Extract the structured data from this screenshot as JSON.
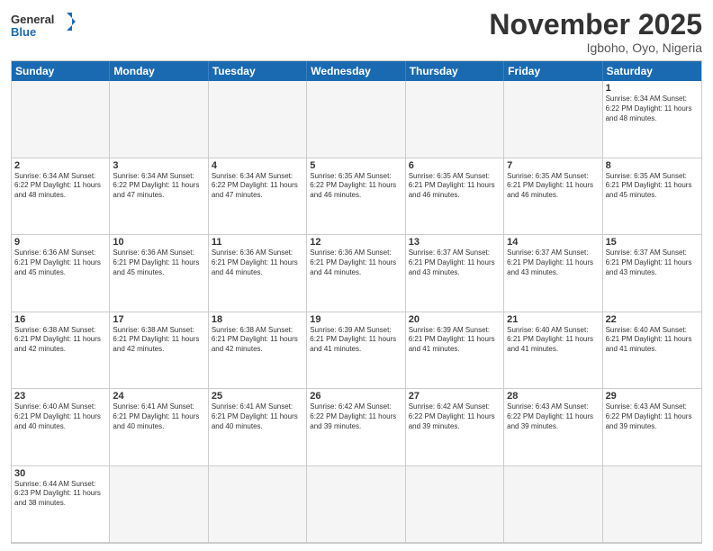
{
  "logo": {
    "general": "General",
    "blue": "Blue"
  },
  "header": {
    "month": "November 2025",
    "location": "Igboho, Oyo, Nigeria"
  },
  "days_of_week": [
    "Sunday",
    "Monday",
    "Tuesday",
    "Wednesday",
    "Thursday",
    "Friday",
    "Saturday"
  ],
  "weeks": [
    [
      {
        "day": "",
        "info": "",
        "empty": true
      },
      {
        "day": "",
        "info": "",
        "empty": true
      },
      {
        "day": "",
        "info": "",
        "empty": true
      },
      {
        "day": "",
        "info": "",
        "empty": true
      },
      {
        "day": "",
        "info": "",
        "empty": true
      },
      {
        "day": "",
        "info": "",
        "empty": true
      },
      {
        "day": "1",
        "info": "Sunrise: 6:34 AM\nSunset: 6:22 PM\nDaylight: 11 hours\nand 48 minutes."
      }
    ],
    [
      {
        "day": "2",
        "info": "Sunrise: 6:34 AM\nSunset: 6:22 PM\nDaylight: 11 hours\nand 48 minutes."
      },
      {
        "day": "3",
        "info": "Sunrise: 6:34 AM\nSunset: 6:22 PM\nDaylight: 11 hours\nand 47 minutes."
      },
      {
        "day": "4",
        "info": "Sunrise: 6:34 AM\nSunset: 6:22 PM\nDaylight: 11 hours\nand 47 minutes."
      },
      {
        "day": "5",
        "info": "Sunrise: 6:35 AM\nSunset: 6:22 PM\nDaylight: 11 hours\nand 46 minutes."
      },
      {
        "day": "6",
        "info": "Sunrise: 6:35 AM\nSunset: 6:21 PM\nDaylight: 11 hours\nand 46 minutes."
      },
      {
        "day": "7",
        "info": "Sunrise: 6:35 AM\nSunset: 6:21 PM\nDaylight: 11 hours\nand 46 minutes."
      },
      {
        "day": "8",
        "info": "Sunrise: 6:35 AM\nSunset: 6:21 PM\nDaylight: 11 hours\nand 45 minutes."
      }
    ],
    [
      {
        "day": "9",
        "info": "Sunrise: 6:36 AM\nSunset: 6:21 PM\nDaylight: 11 hours\nand 45 minutes."
      },
      {
        "day": "10",
        "info": "Sunrise: 6:36 AM\nSunset: 6:21 PM\nDaylight: 11 hours\nand 45 minutes."
      },
      {
        "day": "11",
        "info": "Sunrise: 6:36 AM\nSunset: 6:21 PM\nDaylight: 11 hours\nand 44 minutes."
      },
      {
        "day": "12",
        "info": "Sunrise: 6:36 AM\nSunset: 6:21 PM\nDaylight: 11 hours\nand 44 minutes."
      },
      {
        "day": "13",
        "info": "Sunrise: 6:37 AM\nSunset: 6:21 PM\nDaylight: 11 hours\nand 43 minutes."
      },
      {
        "day": "14",
        "info": "Sunrise: 6:37 AM\nSunset: 6:21 PM\nDaylight: 11 hours\nand 43 minutes."
      },
      {
        "day": "15",
        "info": "Sunrise: 6:37 AM\nSunset: 6:21 PM\nDaylight: 11 hours\nand 43 minutes."
      }
    ],
    [
      {
        "day": "16",
        "info": "Sunrise: 6:38 AM\nSunset: 6:21 PM\nDaylight: 11 hours\nand 42 minutes."
      },
      {
        "day": "17",
        "info": "Sunrise: 6:38 AM\nSunset: 6:21 PM\nDaylight: 11 hours\nand 42 minutes."
      },
      {
        "day": "18",
        "info": "Sunrise: 6:38 AM\nSunset: 6:21 PM\nDaylight: 11 hours\nand 42 minutes."
      },
      {
        "day": "19",
        "info": "Sunrise: 6:39 AM\nSunset: 6:21 PM\nDaylight: 11 hours\nand 41 minutes."
      },
      {
        "day": "20",
        "info": "Sunrise: 6:39 AM\nSunset: 6:21 PM\nDaylight: 11 hours\nand 41 minutes."
      },
      {
        "day": "21",
        "info": "Sunrise: 6:40 AM\nSunset: 6:21 PM\nDaylight: 11 hours\nand 41 minutes."
      },
      {
        "day": "22",
        "info": "Sunrise: 6:40 AM\nSunset: 6:21 PM\nDaylight: 11 hours\nand 41 minutes."
      }
    ],
    [
      {
        "day": "23",
        "info": "Sunrise: 6:40 AM\nSunset: 6:21 PM\nDaylight: 11 hours\nand 40 minutes."
      },
      {
        "day": "24",
        "info": "Sunrise: 6:41 AM\nSunset: 6:21 PM\nDaylight: 11 hours\nand 40 minutes."
      },
      {
        "day": "25",
        "info": "Sunrise: 6:41 AM\nSunset: 6:21 PM\nDaylight: 11 hours\nand 40 minutes."
      },
      {
        "day": "26",
        "info": "Sunrise: 6:42 AM\nSunset: 6:22 PM\nDaylight: 11 hours\nand 39 minutes."
      },
      {
        "day": "27",
        "info": "Sunrise: 6:42 AM\nSunset: 6:22 PM\nDaylight: 11 hours\nand 39 minutes."
      },
      {
        "day": "28",
        "info": "Sunrise: 6:43 AM\nSunset: 6:22 PM\nDaylight: 11 hours\nand 39 minutes."
      },
      {
        "day": "29",
        "info": "Sunrise: 6:43 AM\nSunset: 6:22 PM\nDaylight: 11 hours\nand 39 minutes."
      }
    ],
    [
      {
        "day": "30",
        "info": "Sunrise: 6:44 AM\nSunset: 6:23 PM\nDaylight: 11 hours\nand 38 minutes."
      },
      {
        "day": "",
        "info": "",
        "empty": true
      },
      {
        "day": "",
        "info": "",
        "empty": true
      },
      {
        "day": "",
        "info": "",
        "empty": true
      },
      {
        "day": "",
        "info": "",
        "empty": true
      },
      {
        "day": "",
        "info": "",
        "empty": true
      },
      {
        "day": "",
        "info": "",
        "empty": true
      }
    ]
  ]
}
